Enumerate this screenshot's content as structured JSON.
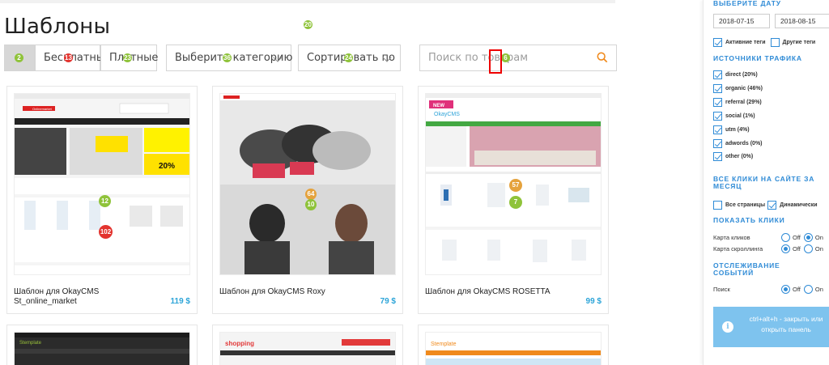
{
  "page": {
    "title": "Шаблоны"
  },
  "filters": {
    "free_label": "Бесплатные",
    "paid_label": "Платные",
    "category_label": "Выберите категорию",
    "sort_label": "Сортировать по",
    "search_placeholder": "Поиск по товарам"
  },
  "heatmap_counts": {
    "title_dot": "20",
    "all_btn": "2",
    "free": "13",
    "paid": "23",
    "category": "36",
    "sort": "24",
    "search": "6",
    "card1_a": "12",
    "card1_b": "102",
    "card2_a": "64",
    "card2_b": "10",
    "card3_a": "57",
    "card3_b": "7"
  },
  "products": [
    {
      "title": "Шаблон для OkayCMS St_online_market",
      "price": "119 $"
    },
    {
      "title": "Шаблон для OkayCMS Roxy",
      "price": "79 $"
    },
    {
      "title": "Шаблон для OkayCMS ROSETTA",
      "price": "99 $"
    }
  ],
  "panel": {
    "date_heading": "ВЫБЕРИТЕ ДАТУ",
    "date_from": "2018-07-15",
    "date_to": "2018-08-15",
    "active_tags": "Активние теги",
    "other_tags": "Другие теги",
    "traffic_heading": "ИСТОЧНИКИ ТРАФИКА",
    "sources": [
      "direct (20%)",
      "organic (46%)",
      "referral (29%)",
      "social (1%)",
      "utm (4%)",
      "adwords (0%)",
      "other (0%)"
    ],
    "clicks_heading": "ВСЕ КЛИКИ НА САЙТЕ ЗА МЕСЯЦ",
    "all_pages": "Все страницы",
    "dynamic": "Динамически",
    "show_clicks_heading": "ПОКАЗАТЬ КЛИКИ",
    "click_map": "Карта кликов",
    "scroll_map": "Карта скроллинга",
    "off": "Off",
    "on": "On",
    "tracking_heading": "ОТСЛЕЖИВАНИЕ СОБЫТИЙ",
    "search_label": "Поиск",
    "hint": "ctrl+alt+h - закрыть или открыть панель"
  },
  "mini": {
    "logo1": "Onlinemarket",
    "sale": "20%",
    "logo3": "OkayCMS",
    "new_badge": "NEW",
    "logo_s": "Stemplate",
    "shopping": "shopping"
  },
  "colors": {
    "accent": "#2f8bd6",
    "price": "#2ca4d8",
    "heat_green": "#8fc33a",
    "heat_red": "#e3342f",
    "heat_orange": "#e5a23c",
    "highlight": "#e00000"
  }
}
